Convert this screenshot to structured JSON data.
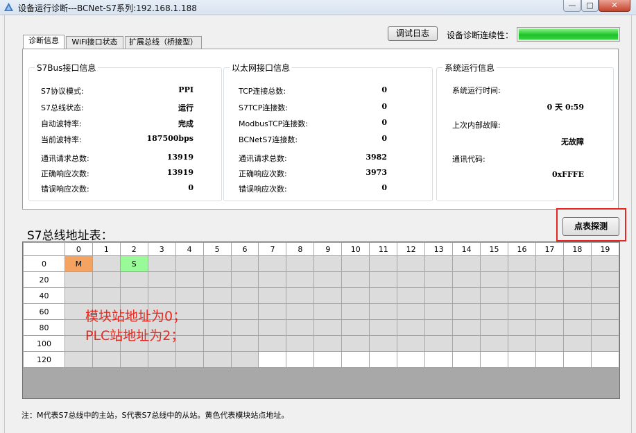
{
  "window": {
    "title": "设备运行诊断---BCNet-S7系列:192.168.1.188",
    "minimize_label": "—",
    "maximize_label": "□",
    "close_label": "✕"
  },
  "toolbar": {
    "log_button": "调试日志",
    "continuity_label": "设备诊断连续性：",
    "continuity_progress": 1.0
  },
  "tabs": {
    "diag": "诊断信息",
    "wifi": "WiFi接口状态",
    "ext": "扩展总线（桥接型）"
  },
  "s7bus": {
    "title": "S7Bus接口信息",
    "rows": [
      {
        "label": "S7协议模式:",
        "value": "PPI"
      },
      {
        "label": "S7总线状态:",
        "value": "运行"
      },
      {
        "label": "自动波特率:",
        "value": "完成"
      },
      {
        "label": "当前波特率:",
        "value": "187500bps"
      },
      {
        "label": "通讯请求总数:",
        "value": "13919"
      },
      {
        "label": "正确响应次数:",
        "value": "13919"
      },
      {
        "label": "错误响应次数:",
        "value": "0"
      }
    ]
  },
  "ethernet": {
    "title": "以太网接口信息",
    "rows": [
      {
        "label": "TCP连接总数:",
        "value": "0"
      },
      {
        "label": "S7TCP连接数:",
        "value": "0"
      },
      {
        "label": "ModbusTCP连接数:",
        "value": "0"
      },
      {
        "label": "BCNetS7连接数:",
        "value": "0"
      },
      {
        "label": "通讯请求总数:",
        "value": "3982"
      },
      {
        "label": "正确响应次数:",
        "value": "3973"
      },
      {
        "label": "错误响应次数:",
        "value": "0"
      }
    ]
  },
  "system": {
    "title": "系统运行信息",
    "runtime_label": "系统运行时间:",
    "runtime_value": "0 天 0:59",
    "fault_label": "上次内部故障:",
    "fault_value": "无故障",
    "code_label": "通讯代码:",
    "code_value": "0xFFFE"
  },
  "address_table": {
    "title": "S7总线地址表：",
    "probe_button": "点表探测",
    "columns": [
      "0",
      "1",
      "2",
      "3",
      "4",
      "5",
      "6",
      "7",
      "8",
      "9",
      "10",
      "11",
      "12",
      "13",
      "14",
      "15",
      "16",
      "17",
      "18",
      "19"
    ],
    "rows": [
      "0",
      "20",
      "40",
      "60",
      "80",
      "100",
      "120"
    ],
    "master_label": "M",
    "slave_label": "S",
    "master_address": 0,
    "slave_address": 2,
    "max_address": 126
  },
  "annotations": {
    "line1": "模块站地址为0；",
    "line2": "PLC站地址为2；"
  },
  "footer": {
    "note": "注：M代表S7总线中的主站，S代表S7总线中的从站。黄色代表模块站点地址。"
  }
}
